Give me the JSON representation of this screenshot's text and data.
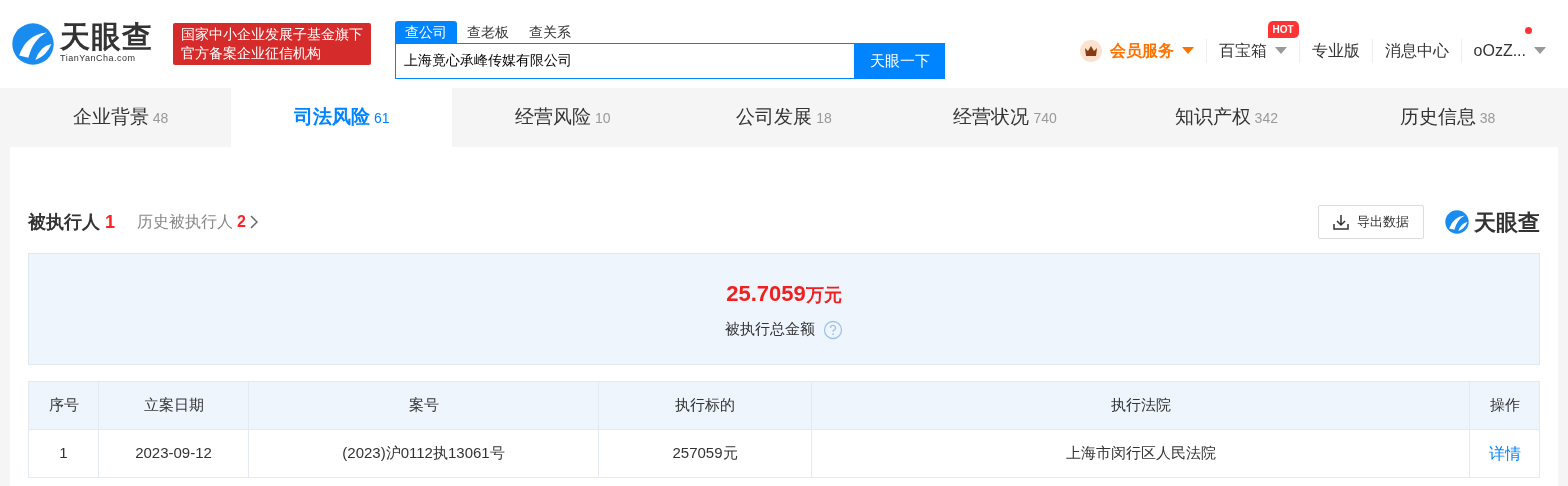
{
  "header": {
    "logo": {
      "name": "天眼查",
      "domain": "TianYanCha.com"
    },
    "banner": [
      "国家中小企业发展子基金旗下",
      "官方备案企业征信机构"
    ],
    "search": {
      "tabs": [
        {
          "label": "查公司",
          "selected": true
        },
        {
          "label": "查老板",
          "selected": false
        },
        {
          "label": "查关系",
          "selected": false
        }
      ],
      "value": "上海竟心承峰传媒有限公司",
      "button": "天眼一下"
    },
    "nav": [
      {
        "kind": "vip",
        "label": "会员服务",
        "dropdown": true
      },
      {
        "kind": "link",
        "label": "百宝箱",
        "dropdown": true,
        "badge": "HOT"
      },
      {
        "kind": "link",
        "label": "专业版",
        "dropdown": false
      },
      {
        "kind": "link",
        "label": "消息中心",
        "dropdown": false
      },
      {
        "kind": "user",
        "label": "oOzZ...",
        "dropdown": true,
        "unread": true
      }
    ]
  },
  "tabs": [
    {
      "label": "企业背景",
      "count": "48",
      "selected": false
    },
    {
      "label": "司法风险",
      "count": "61",
      "selected": true
    },
    {
      "label": "经营风险",
      "count": "10",
      "selected": false
    },
    {
      "label": "公司发展",
      "count": "18",
      "selected": false
    },
    {
      "label": "经营状况",
      "count": "740",
      "selected": false
    },
    {
      "label": "知识产权",
      "count": "342",
      "selected": false
    },
    {
      "label": "历史信息",
      "count": "38",
      "selected": false
    }
  ],
  "section": {
    "title": "被执行人",
    "count": "1",
    "history_label": "历史被执行人",
    "history_count": "2",
    "export_button": "导出数据",
    "brand": "天眼查"
  },
  "summary": {
    "amount": "25.7059",
    "unit": "万元",
    "label": "被执行总金额"
  },
  "table": {
    "columns": [
      "序号",
      "立案日期",
      "案号",
      "执行标的",
      "执行法院",
      "操作"
    ],
    "rows": [
      [
        "1",
        "2023-09-12",
        "(2023)沪0112执13061号",
        "257059元",
        "上海市闵行区人民法院",
        "详情"
      ]
    ]
  }
}
